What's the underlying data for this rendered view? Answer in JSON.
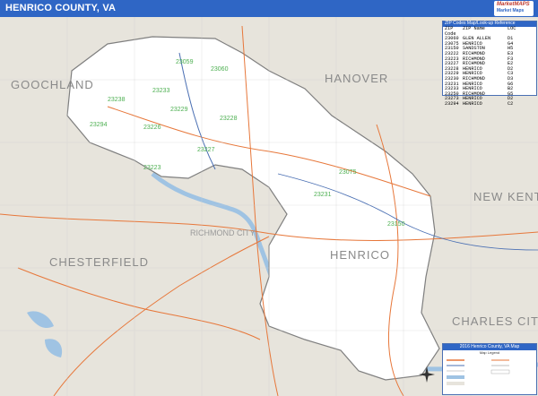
{
  "title": "HENRICO COUNTY, VA",
  "logo": {
    "line1": "MarketMAPS",
    "line2": "Market Maps"
  },
  "colors": {
    "title_bar": "#2f66c5",
    "background_land": "#e7e4dc",
    "county_fill": "#ffffff",
    "water": "#9fc3e3",
    "roads": "#e7773a",
    "zip_labels": "#4caf50"
  },
  "county_labels": [
    "GOOCHLAND",
    "HANOVER",
    "NEW KENT",
    "CHESTERFIELD",
    "CHARLES CITY",
    "HENRICO"
  ],
  "city_labels": [
    "RICHMOND CITY"
  ],
  "zip_labels": [
    "23059",
    "23060",
    "23233",
    "23238",
    "23229",
    "23226",
    "23294",
    "23228",
    "23227",
    "23223",
    "23075",
    "23231",
    "23150"
  ],
  "zip_table": {
    "header": "ZIP Codes Map/Look-up Reference",
    "columns": [
      "ZIP Code",
      "ZIP Name",
      "LOC"
    ],
    "rows": [
      [
        "23060",
        "GLEN ALLEN",
        "D1"
      ],
      [
        "23075",
        "HENRICO",
        "G4"
      ],
      [
        "23150",
        "SANDSTON",
        "H5"
      ],
      [
        "23222",
        "RICHMOND",
        "E3"
      ],
      [
        "23223",
        "RICHMOND",
        "F3"
      ],
      [
        "23227",
        "RICHMOND",
        "E2"
      ],
      [
        "23228",
        "HENRICO",
        "D2"
      ],
      [
        "23229",
        "HENRICO",
        "C3"
      ],
      [
        "23230",
        "RICHMOND",
        "D3"
      ],
      [
        "23231",
        "HENRICO",
        "G6"
      ],
      [
        "23233",
        "HENRICO",
        "B2"
      ],
      [
        "23250",
        "RICHMOND",
        "G5"
      ],
      [
        "23273",
        "HENRICO",
        "D2"
      ],
      [
        "23294",
        "HENRICO",
        "C2"
      ]
    ]
  },
  "legend": {
    "title": "2016 Henrico County, VA Map",
    "subtitle": "Map Legend"
  }
}
